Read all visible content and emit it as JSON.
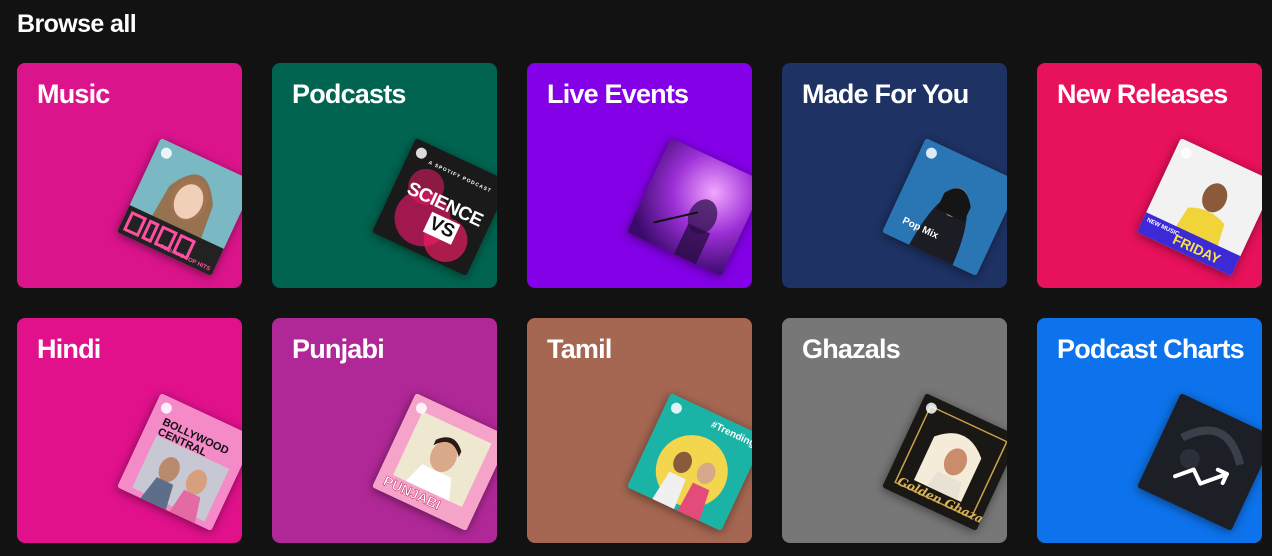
{
  "page": {
    "heading": "Browse all"
  },
  "cards": [
    {
      "label": "Music",
      "bg": "#dc148c"
    },
    {
      "label": "Podcasts",
      "bg": "#006450"
    },
    {
      "label": "Live Events",
      "bg": "#8400e7"
    },
    {
      "label": "Made For You",
      "bg": "#1e3264"
    },
    {
      "label": "New Releases",
      "bg": "#e8115b"
    },
    {
      "label": "Hindi",
      "bg": "#e1118c"
    },
    {
      "label": "Punjabi",
      "bg": "#b02897"
    },
    {
      "label": "Tamil",
      "bg": "#a56752"
    },
    {
      "label": "Ghazals",
      "bg": "#777777"
    },
    {
      "label": "Podcast Charts",
      "bg": "#0d73ec"
    }
  ],
  "artwork": {
    "music": {
      "text": "TODAY'S TOP HITS"
    },
    "podcasts": {
      "small": "A SPOTIFY PODCAST",
      "line1": "SCIENCE",
      "line2": "VS"
    },
    "made_for_you": {
      "text": "Pop Mix"
    },
    "new_releases": {
      "text1": "NEW MUSIC",
      "text2": "FRIDAY"
    },
    "hindi": {
      "text": "BOLLYWOOD CENTRAL"
    },
    "punjabi": {
      "text": "PUNJABI"
    },
    "tamil": {
      "text": "#Trending"
    },
    "ghazals": {
      "text": "Golden Ghazal"
    }
  }
}
